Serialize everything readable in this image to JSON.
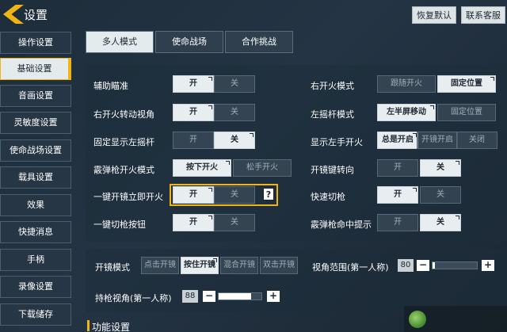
{
  "header": {
    "title": "设置",
    "restore_default": "恢复默认",
    "contact_support": "联系客服"
  },
  "sidebar": {
    "items": [
      {
        "label": "操作设置"
      },
      {
        "label": "基础设置"
      },
      {
        "label": "音画设置"
      },
      {
        "label": "灵敏度设置"
      },
      {
        "label": "使命战场设置"
      },
      {
        "label": "载具设置"
      },
      {
        "label": "效果"
      },
      {
        "label": "快捷消息"
      },
      {
        "label": "手柄"
      },
      {
        "label": "录像设置"
      },
      {
        "label": "下载储存"
      }
    ],
    "active_index": 1
  },
  "tabs": [
    {
      "label": "多人模式"
    },
    {
      "label": "使命战场"
    },
    {
      "label": "合作挑战"
    }
  ],
  "settings": {
    "aim_assist": {
      "label": "辅助瞄准",
      "options": [
        "开",
        "关"
      ],
      "selected": "开"
    },
    "fire_rotate": {
      "label": "右开火转动视角",
      "options": [
        "开",
        "关"
      ],
      "selected": "开"
    },
    "fixed_left_stick": {
      "label": "固定显示左摇杆",
      "options": [
        "开",
        "关"
      ],
      "selected": "关"
    },
    "shotgun_fire_mode": {
      "label": "霰弹枪开火模式",
      "options": [
        "按下开火",
        "松手开火"
      ],
      "selected": "按下开火"
    },
    "ads_fire": {
      "label": "一键开镜立即开火",
      "options": [
        "开",
        "关"
      ],
      "selected": "开"
    },
    "quick_switch_button": {
      "label": "一键切枪按钮",
      "options": [
        "开",
        "关"
      ],
      "selected": "开"
    },
    "right_fire_mode": {
      "label": "右开火模式",
      "options": [
        "跟随开火",
        "固定位置"
      ],
      "selected": "固定位置"
    },
    "left_stick_mode": {
      "label": "左摇杆模式",
      "options": [
        "左半屏移动",
        "固定位置"
      ],
      "selected": "左半屏移动"
    },
    "left_fire_button": {
      "label": "显示左手开火",
      "options": [
        "总是开启",
        "开镜开启",
        "关闭"
      ],
      "selected": "总是开启"
    },
    "fire_key_steer": {
      "label": "开镜键转向",
      "options": [
        "开",
        "关"
      ],
      "selected": "关"
    },
    "quick_switch": {
      "label": "快速切枪",
      "options": [
        "开",
        "关"
      ],
      "selected": "开"
    },
    "shotgun_hit_hint": {
      "label": "霰弹枪命中提示",
      "options": [
        "开",
        "关"
      ],
      "selected": "开"
    }
  },
  "scope": {
    "mode_label": "开镜模式",
    "mode_options": [
      "点击开镜",
      "按住开镜",
      "混合开镜",
      "双击开镜"
    ],
    "mode_selected": "按住开镜",
    "fov_label": "视角范围(第一人称)",
    "fov_value": "80",
    "fov_fill": 0.05,
    "gun_fov_label": "持枪视角(第一人称)",
    "gun_fov_value": "88",
    "gun_fov_fill": 0.75,
    "minus": "−",
    "plus": "+"
  },
  "help_icon_text": "?",
  "section_function": "功能设置",
  "watermark_text": "",
  "colors": {
    "accent": "#f0b414",
    "selected_bg": "#e8eef0"
  }
}
